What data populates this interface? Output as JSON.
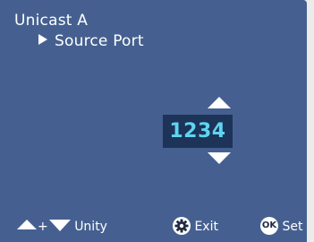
{
  "screen": {
    "title": "Unicast A",
    "subtitle": "Source Port"
  },
  "value": {
    "current": "1234"
  },
  "footer": {
    "unity_label": "Unity",
    "plus_label": "+",
    "exit_label": "Exit",
    "set_label": "Set",
    "ok_icon_text": "OK"
  },
  "colors": {
    "background": "#456090",
    "value_box": "#1d3358",
    "value_text": "#5fd4f0"
  },
  "icons": [
    "right-triangle-icon",
    "up-arrow-icon",
    "down-arrow-icon",
    "gear-icon",
    "ok-icon"
  ]
}
